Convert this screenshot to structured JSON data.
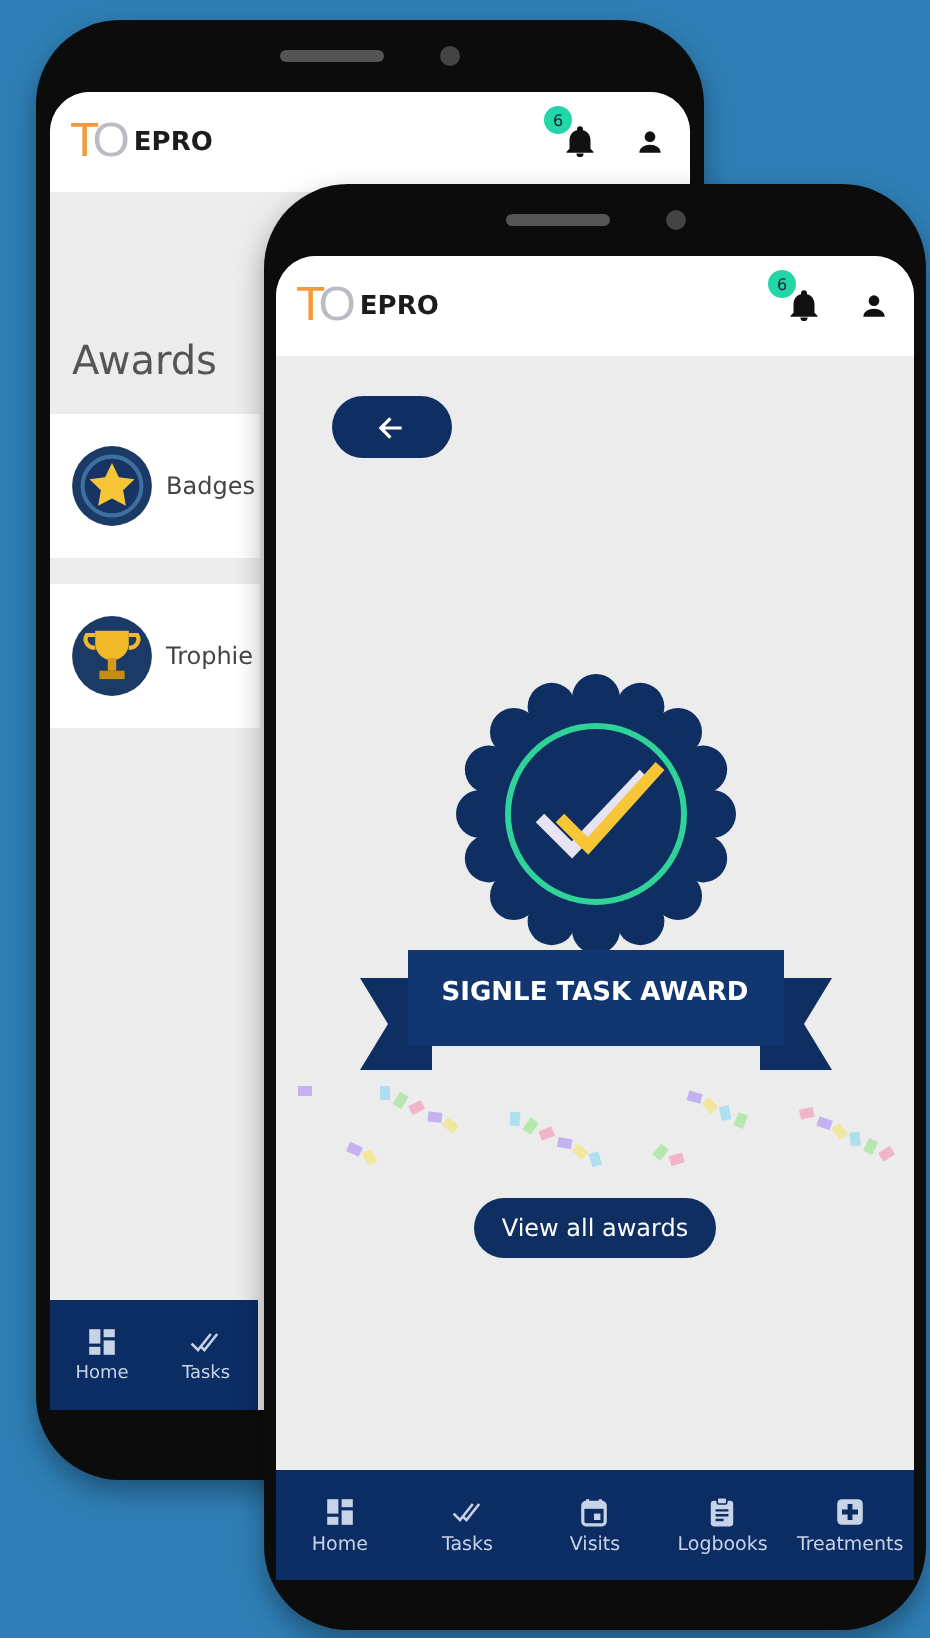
{
  "back_screen": {
    "logo_mark": "TO",
    "logo_name": "EPRO",
    "notification_count": "6",
    "title": "Awards",
    "award_types": [
      {
        "kind": "badge",
        "label": "Badges"
      },
      {
        "kind": "trophy",
        "label": "Trophie"
      }
    ],
    "nav": [
      {
        "kind": "home",
        "label": "Home"
      },
      {
        "kind": "tasks",
        "label": "Tasks"
      }
    ]
  },
  "front_screen": {
    "logo_mark": "TO",
    "logo_name": "EPRO",
    "notification_count": "6",
    "award_title": "SIGNLE TASK AWARD",
    "view_all_button": "View all awards",
    "nav": [
      {
        "kind": "home",
        "label": "Home"
      },
      {
        "kind": "tasks",
        "label": "Tasks"
      },
      {
        "kind": "visits",
        "label": "Visits"
      },
      {
        "kind": "logbooks",
        "label": "Logbooks"
      },
      {
        "kind": "treatments",
        "label": "Treatments"
      }
    ]
  }
}
